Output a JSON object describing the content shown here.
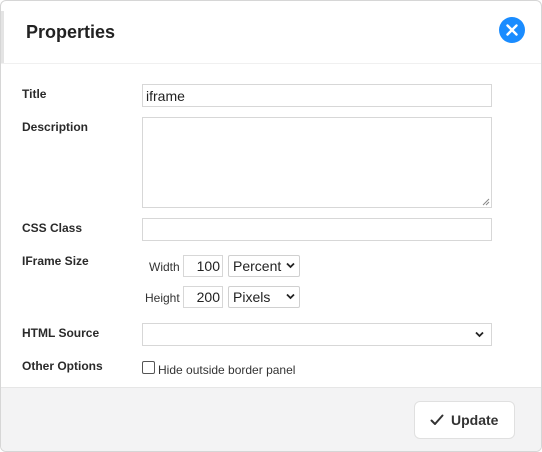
{
  "dialog": {
    "title": "Properties",
    "close_icon": "close-icon"
  },
  "fields": {
    "title_label": "Title",
    "title_value": "iframe",
    "description_label": "Description",
    "description_value": "",
    "css_class_label": "CSS Class",
    "css_class_value": "",
    "iframe_size_label": "IFrame Size",
    "width_label": "Width",
    "width_value": "100",
    "width_unit": "Percent",
    "height_label": "Height",
    "height_value": "200",
    "height_unit": "Pixels",
    "html_source_label": "HTML Source",
    "html_source_value": "",
    "other_options_label": "Other Options",
    "hide_border_label": "Hide outside border panel",
    "hide_border_checked": false
  },
  "footer": {
    "update_label": "Update",
    "update_icon": "checkmark-icon"
  },
  "colors": {
    "accent": "#1a8cff",
    "footer_bg": "#f3f3f4"
  }
}
